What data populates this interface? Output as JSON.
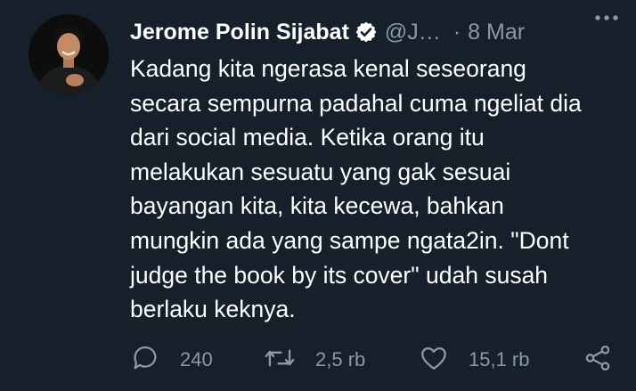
{
  "tweet": {
    "author_name": "Jerome Polin Sijabat",
    "handle": "@J…",
    "separator": "·",
    "date": "8 Mar",
    "text": "Kadang kita ngerasa kenal seseorang\nsecara sempurna padahal cuma ngeliat dia\ndari social media. Ketika orang itu\nmelakukan sesuatu yang gak sesuai\nbayangan kita, kita kecewa, bahkan\nmungkin ada yang sampe ngata2in. \"Dont\njudge the book by its cover\" udah susah\nberlaku keknya.",
    "verified_icon": "verified-badge-icon",
    "more_icon": "more-options-icon"
  },
  "actions": {
    "reply_count": "240",
    "retweet_count": "2,5 rb",
    "like_count": "15,1 rb",
    "reply_icon": "reply-icon",
    "retweet_icon": "retweet-icon",
    "like_icon": "heart-icon",
    "share_icon": "share-icon"
  },
  "colors": {
    "background": "#15202b",
    "text_primary": "#ffffff",
    "text_secondary": "#8b98a5"
  }
}
